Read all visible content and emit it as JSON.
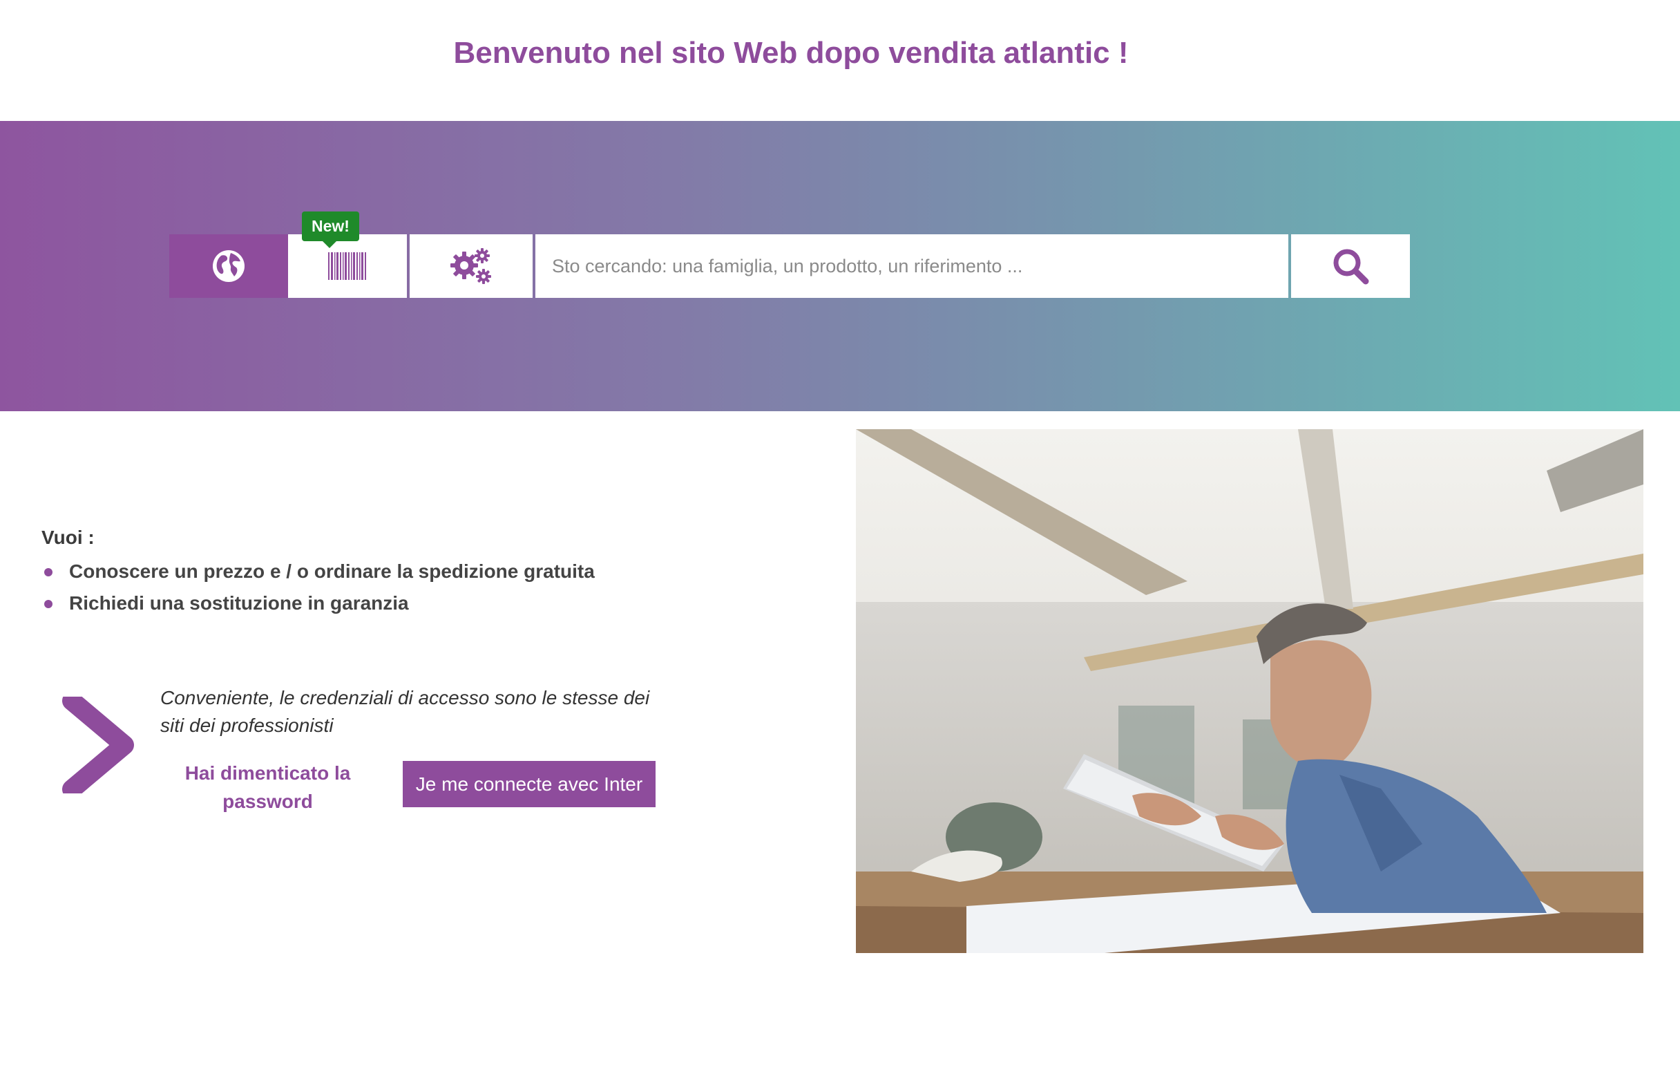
{
  "header": {
    "title": "Benvenuto nel sito Web dopo vendita atlantic !"
  },
  "search": {
    "badge": "New!",
    "placeholder": "Sto cercando: una famiglia, un prodotto, un riferimento ...",
    "tabs": [
      "globe-icon",
      "barcode-icon",
      "gears-icon"
    ],
    "submit_icon": "search-icon"
  },
  "intro": {
    "label": "Vuoi :",
    "items": [
      "Conoscere un prezzo e / o ordinare la spedizione gratuita",
      "Richiedi una sostituzione in garanzia"
    ]
  },
  "login": {
    "note": "Conveniente, le credenziali di accesso sono le stesse dei siti dei professionisti",
    "forgot_password": "Hai dimenticato la password",
    "connect_button": "Je me connecte avec Inter"
  },
  "colors": {
    "brand_purple": "#8e4c9c",
    "badge_green": "#1f8a2a",
    "gradient_start": "#8e559f",
    "gradient_end": "#62c2b6"
  }
}
